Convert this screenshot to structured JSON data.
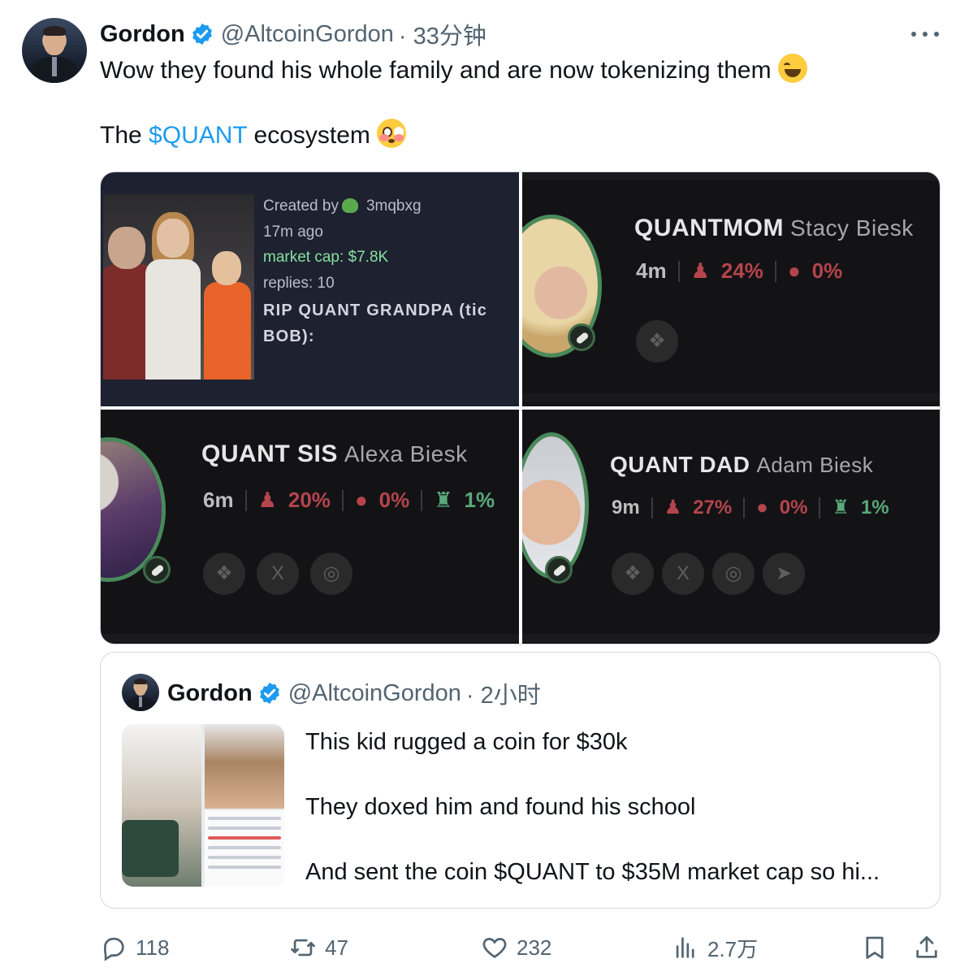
{
  "tweet": {
    "author": {
      "name": "Gordon",
      "handle": "@AltcoinGordon",
      "time": "· 33分钟"
    },
    "line1": "Wow they found his whole family and are now tokenizing them",
    "line2_prefix": "The",
    "cashtag": "$QUANT",
    "line2_suffix": "ecosystem"
  },
  "media": {
    "tile_a": {
      "created_by_label": "Created by",
      "creator": "3mqbxg",
      "age": "17m ago",
      "market_cap": "market cap: $7.8K",
      "replies": "replies: 10",
      "title_line1": "RIP QUANT GRANDPA (tic",
      "title_line2": "BOB):"
    },
    "tile_b": {
      "ticker": "QUANTMOM",
      "name": "Stacy Biesk",
      "age": "4m",
      "holders": "24%",
      "dev": "0%"
    },
    "tile_c": {
      "ticker": "QUANT SIS",
      "name": "Alexa Biesk",
      "age": "6m",
      "holders": "20%",
      "dev": "0%",
      "snipers": "1%"
    },
    "tile_d": {
      "ticker": "QUANT DAD",
      "name": "Adam Biesk",
      "age": "9m",
      "holders": "27%",
      "dev": "0%",
      "snipers": "1%"
    }
  },
  "quote": {
    "author": {
      "name": "Gordon",
      "handle": "@AltcoinGordon",
      "time": "· 2小时"
    },
    "line1": "This kid rugged a coin for $30k",
    "line2": "They doxed him and found his school",
    "line3": "And sent the coin $QUANT to $35M market cap so hi..."
  },
  "actions": {
    "replies": "118",
    "reposts": "47",
    "likes": "232",
    "views": "2.7万"
  },
  "colors": {
    "accent": "#1d9bf0",
    "text": "#0f1419",
    "muted": "#536471",
    "border": "#cfd9de"
  }
}
